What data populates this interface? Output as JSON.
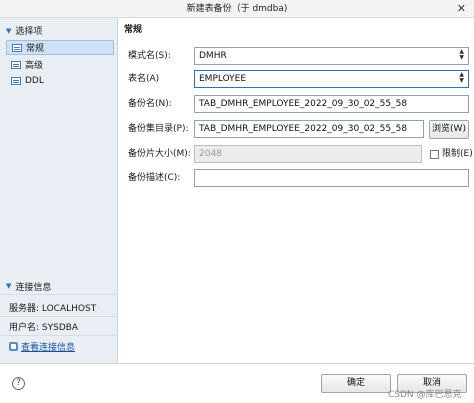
{
  "window": {
    "title": "新建表备份（于 dmdba)",
    "close_glyph": "✕"
  },
  "sidebar": {
    "section_title": "选择项",
    "items": [
      {
        "label": "常规",
        "active": true
      },
      {
        "label": "高级",
        "active": false
      },
      {
        "label": "DDL",
        "active": false
      }
    ],
    "connection_title": "连接信息",
    "server": "服务器: LOCALHOST",
    "user": "用户名: SYSDBA",
    "view_link": "查看连接信息"
  },
  "main": {
    "title": "常规",
    "schema_label": "模式名(S):",
    "schema_value": "DMHR",
    "table_label": "表名(A)",
    "table_value": "EMPLOYEE",
    "backup_name_label": "备份名(N):",
    "backup_name_value": "TAB_DMHR_EMPLOYEE_2022_09_30_02_55_58",
    "backup_dir_label": "备份集目录(P):",
    "backup_dir_value": "TAB_DMHR_EMPLOYEE_2022_09_30_02_55_58",
    "browse_label": "浏览(W)",
    "piece_size_label": "备份片大小(M):",
    "piece_size_value": "2048",
    "limit_label": "限制(E)",
    "desc_label": "备份描述(C):",
    "desc_value": ""
  },
  "footer": {
    "help_glyph": "?",
    "ok_label": "确定",
    "cancel_label": "取消",
    "watermark": "CSDN @库巴恩克"
  }
}
